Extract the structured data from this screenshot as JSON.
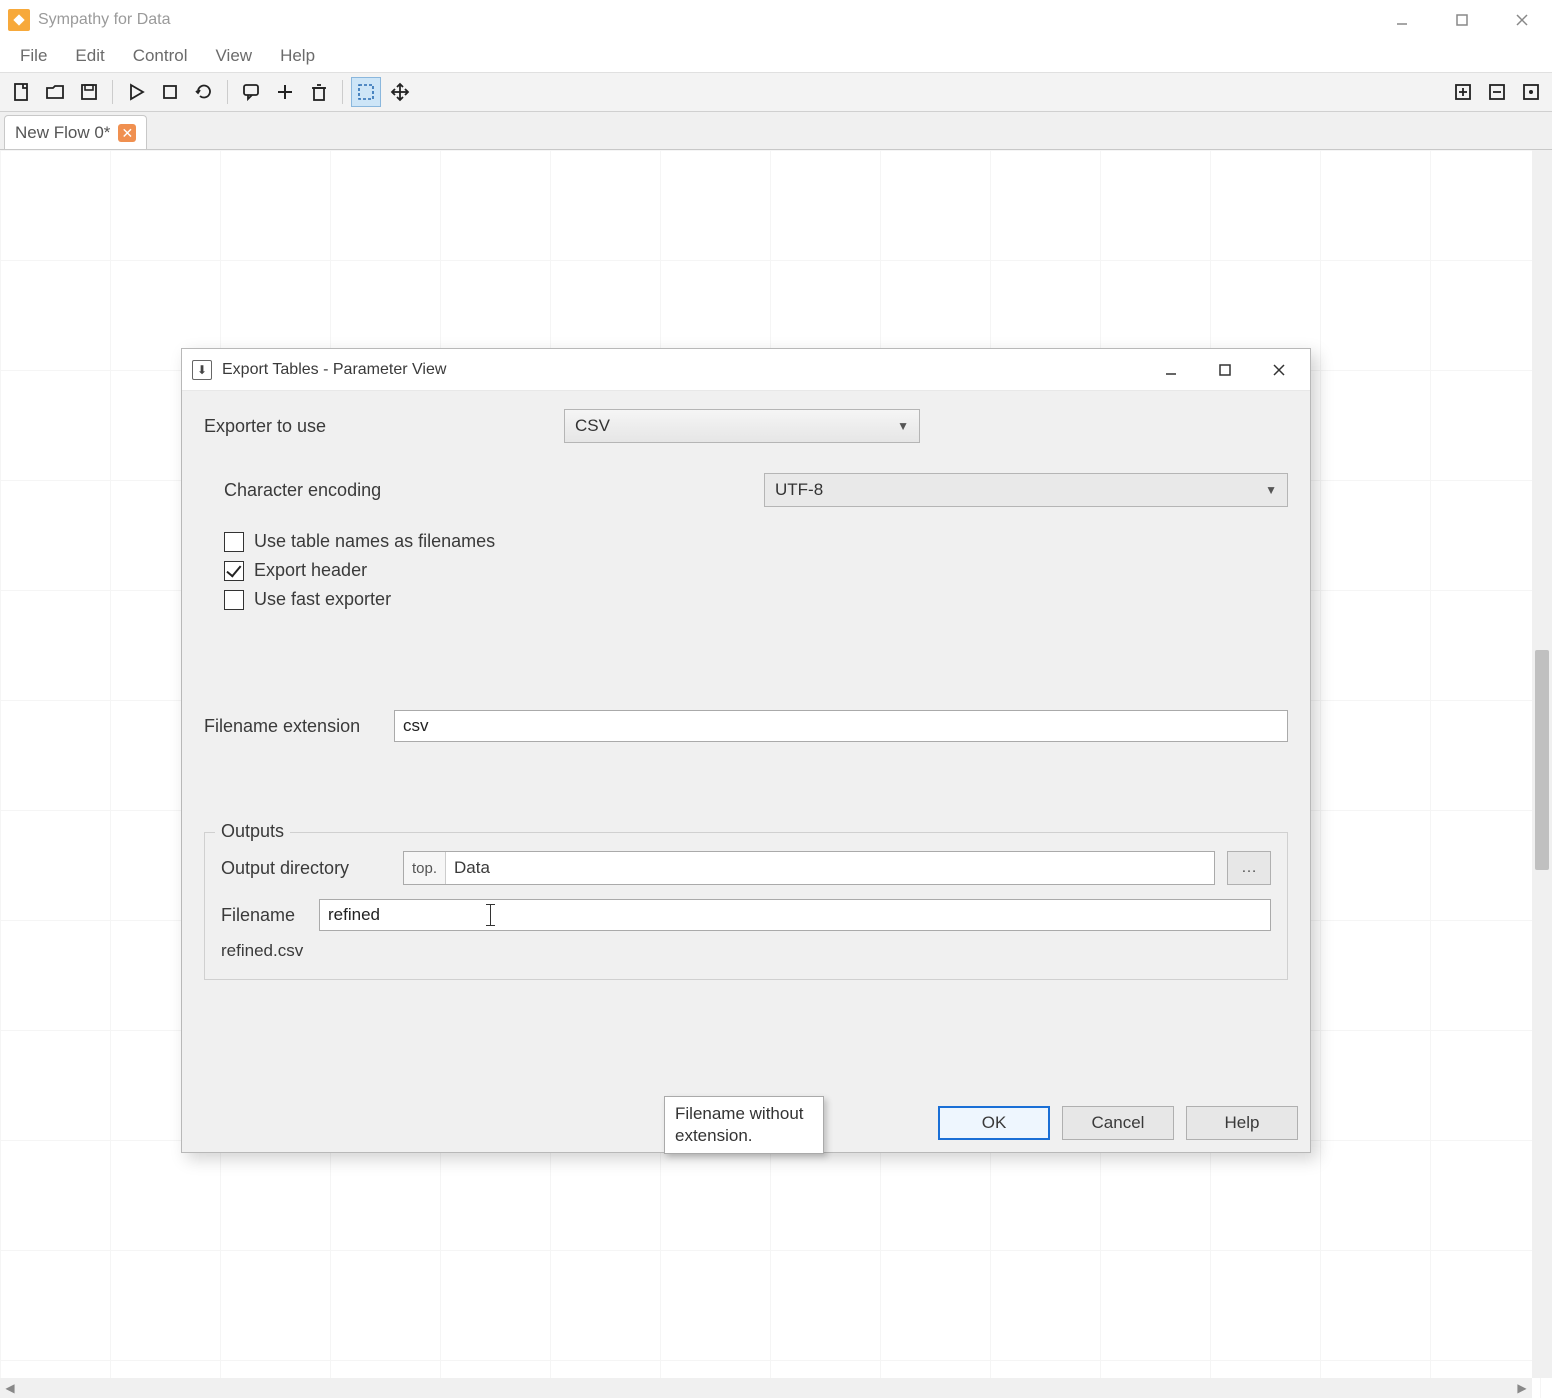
{
  "app": {
    "title": "Sympathy for Data"
  },
  "menu": {
    "file": "File",
    "edit": "Edit",
    "control": "Control",
    "view": "View",
    "help": "Help"
  },
  "tab": {
    "label": "New Flow 0*"
  },
  "dialog": {
    "title": "Export Tables - Parameter View",
    "exporter_label": "Exporter to use",
    "exporter_value": "CSV",
    "encoding_label": "Character encoding",
    "encoding_value": "UTF-8",
    "chk_use_table_names": "Use table names as filenames",
    "chk_export_header": "Export header",
    "chk_fast_exporter": "Use fast exporter",
    "filename_ext_label": "Filename extension",
    "filename_ext_value": "csv",
    "outputs_legend": "Outputs",
    "output_dir_label": "Output directory",
    "output_dir_prefix": "top.",
    "output_dir_value": "Data",
    "browse_label": "…",
    "filename_label": "Filename",
    "filename_value": "refined",
    "preview_filename": "refined.csv",
    "tooltip": "Filename without extension.",
    "btn_ok": "OK",
    "btn_cancel": "Cancel",
    "btn_help": "Help",
    "chk_states": {
      "use_table_names": false,
      "export_header": true,
      "fast_exporter": false
    }
  }
}
